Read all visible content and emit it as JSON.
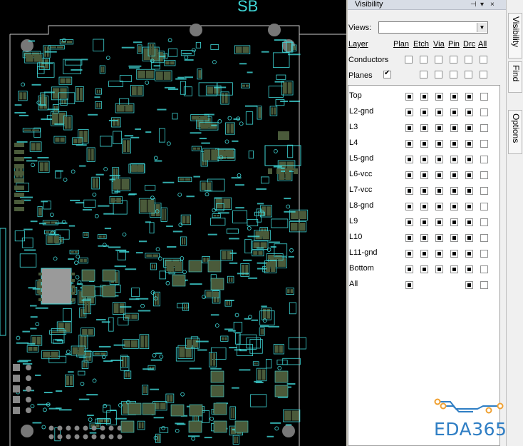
{
  "canvas": {
    "top_label": "SB"
  },
  "panel": {
    "title": "Visibility",
    "pin_glyph": "⊣",
    "dropdown_glyph": "▾",
    "close_glyph": "×",
    "views_label": "Views:",
    "views_value": "",
    "views_arrow": "▼",
    "header": {
      "layer": "Layer",
      "plan": "Plan",
      "etch": "Etch",
      "via": "Via",
      "pin": "Pin",
      "drc": "Drc",
      "all": "All"
    },
    "conductors_label": "Conductors",
    "planes_label": "Planes",
    "planes_checked": true,
    "layers": [
      {
        "name": "Top",
        "state": "full"
      },
      {
        "name": "L2-gnd",
        "state": "full"
      },
      {
        "name": "L3",
        "state": "full"
      },
      {
        "name": "L4",
        "state": "full"
      },
      {
        "name": "L5-gnd",
        "state": "full"
      },
      {
        "name": "L6-vcc",
        "state": "full"
      },
      {
        "name": "L7-vcc",
        "state": "full"
      },
      {
        "name": "L8-gnd",
        "state": "full"
      },
      {
        "name": "L9",
        "state": "full"
      },
      {
        "name": "L10",
        "state": "full"
      },
      {
        "name": "L11-gnd",
        "state": "full"
      },
      {
        "name": "Bottom",
        "state": "full"
      },
      {
        "name": "All",
        "state": "partial"
      }
    ]
  },
  "tabs": [
    "Visibility",
    "Find",
    "Options"
  ],
  "logo": {
    "text": "EDA365",
    "color": "#2f7ec4",
    "accent": "#f0a030"
  },
  "colors": {
    "pcb_outline": "#3fd6d6",
    "pad": "#4a5a3a",
    "background": "#000000"
  }
}
